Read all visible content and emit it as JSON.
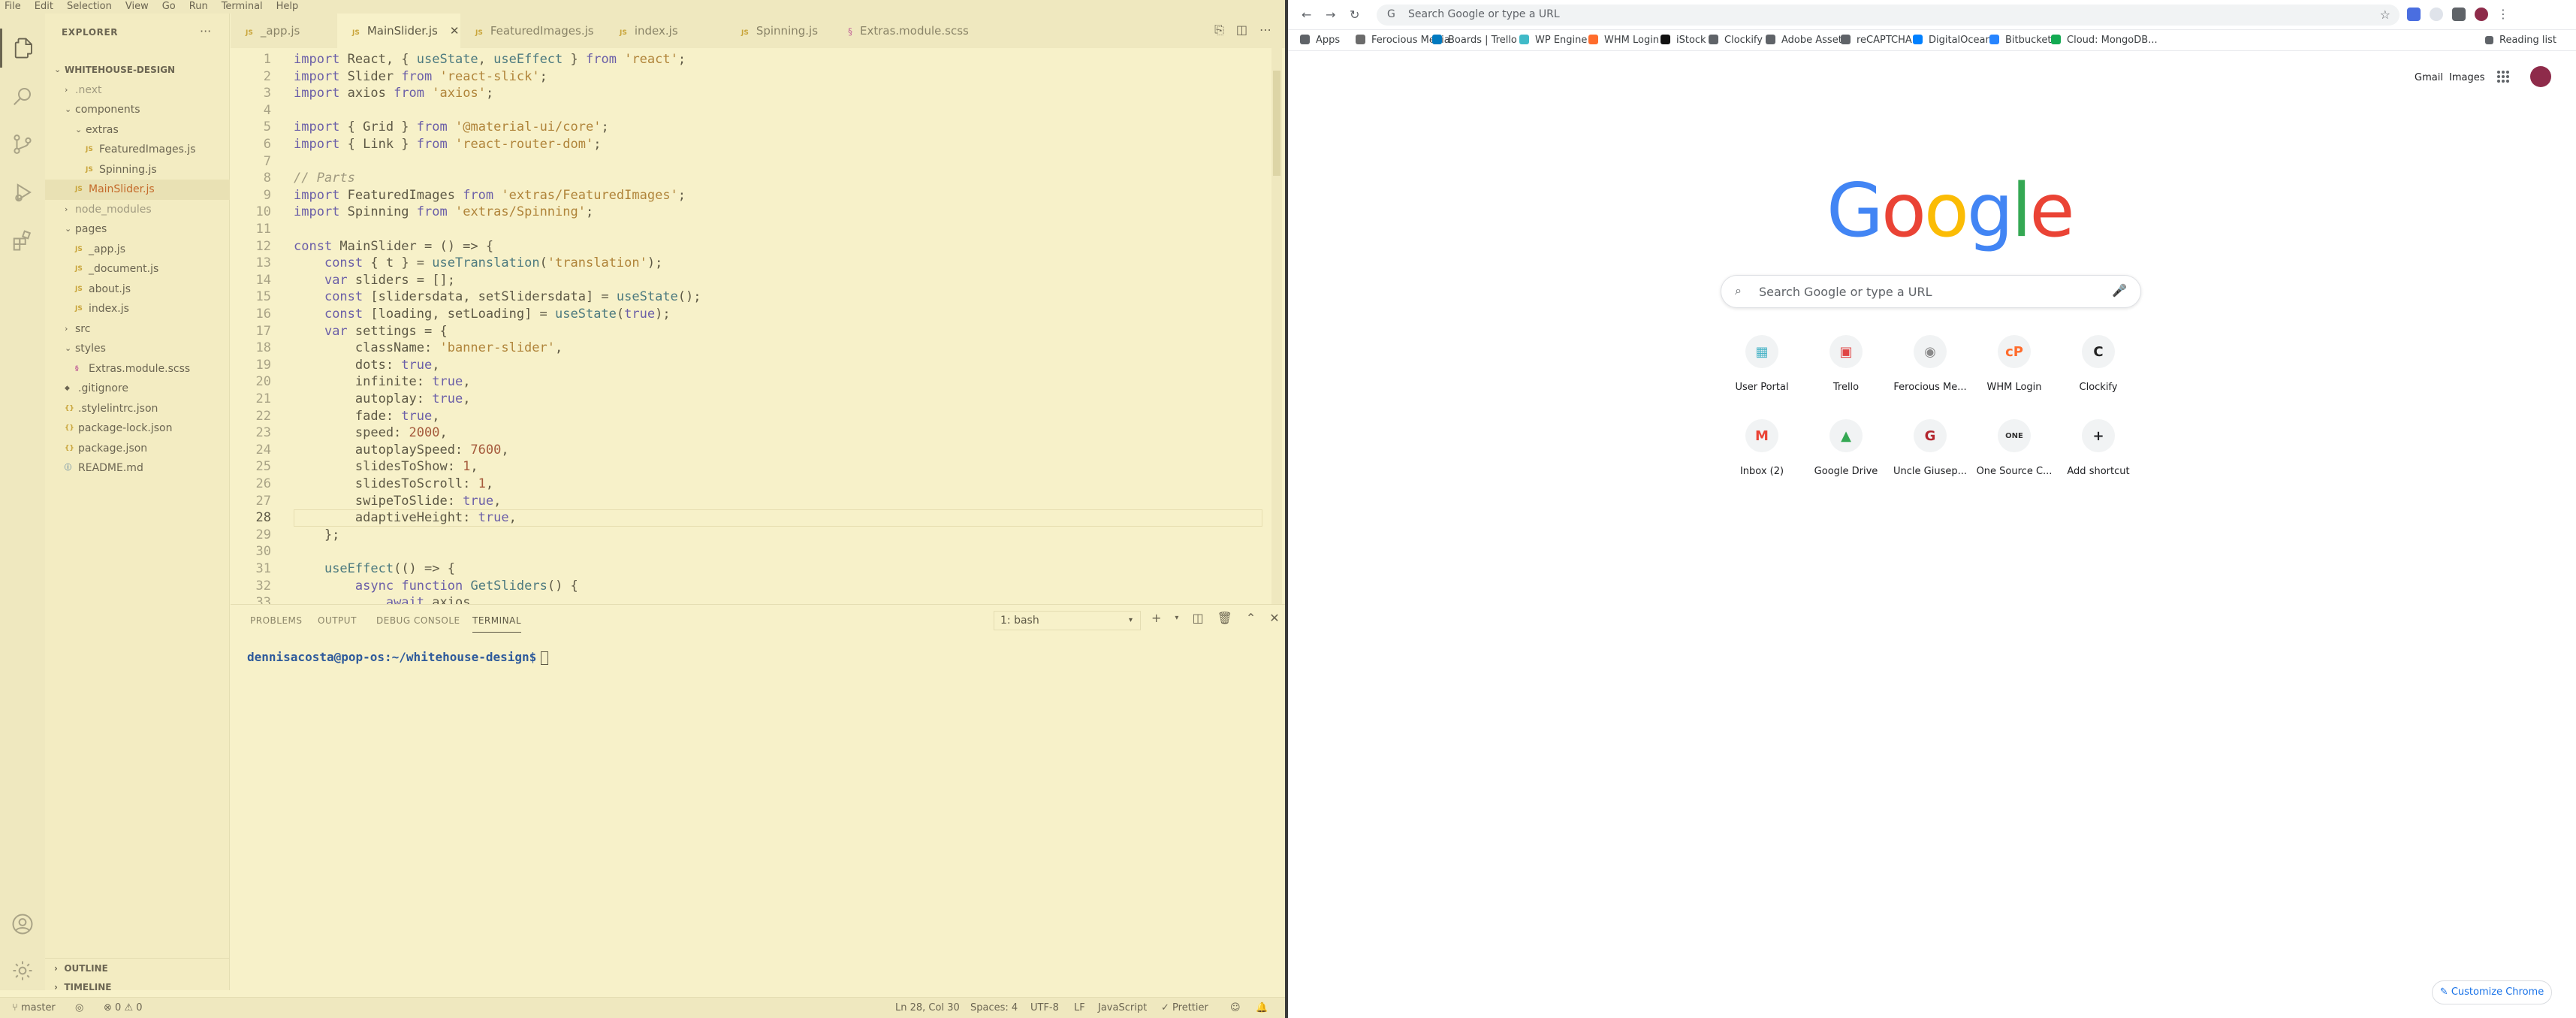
{
  "vscode": {
    "menu": [
      "File",
      "Edit",
      "Selection",
      "View",
      "Go",
      "Run",
      "Terminal",
      "Help"
    ],
    "explorer_title": "EXPLORER",
    "explorer_more": "···",
    "tree": [
      {
        "label": "WHITEHOUSE-DESIGN",
        "type": "root"
      },
      {
        "label": ".next",
        "type": "folder",
        "state": "collapsed",
        "muted": true
      },
      {
        "label": "components",
        "type": "folder",
        "state": "expanded"
      },
      {
        "label": "extras",
        "type": "folder",
        "state": "expanded"
      },
      {
        "label": "FeaturedImages.js",
        "type": "js"
      },
      {
        "label": "Spinning.js",
        "type": "js"
      },
      {
        "label": "MainSlider.js",
        "type": "js",
        "selected": true
      },
      {
        "label": "node_modules",
        "type": "folder",
        "state": "collapsed",
        "muted": true
      },
      {
        "label": "pages",
        "type": "folder",
        "state": "expanded"
      },
      {
        "label": "_app.js",
        "type": "js"
      },
      {
        "label": "_document.js",
        "type": "js"
      },
      {
        "label": "about.js",
        "type": "js"
      },
      {
        "label": "index.js",
        "type": "js"
      },
      {
        "label": "src",
        "type": "folder",
        "state": "collapsed"
      },
      {
        "label": "styles",
        "type": "folder",
        "state": "expanded"
      },
      {
        "label": "Extras.module.scss",
        "type": "scss"
      },
      {
        "label": ".gitignore",
        "type": "git"
      },
      {
        "label": ".stylelintrc.json",
        "type": "json"
      },
      {
        "label": "package-lock.json",
        "type": "json"
      },
      {
        "label": "package.json",
        "type": "json"
      },
      {
        "label": "README.md",
        "type": "md"
      }
    ],
    "outline": "OUTLINE",
    "timeline": "TIMELINE",
    "tabs": [
      {
        "label": "_app.js",
        "icon": "JS"
      },
      {
        "label": "MainSlider.js",
        "icon": "JS",
        "active": true
      },
      {
        "label": "FeaturedImages.js",
        "icon": "JS"
      },
      {
        "label": "index.js",
        "icon": "JS"
      },
      {
        "label": "Spinning.js",
        "icon": "JS"
      },
      {
        "label": "Extras.module.scss",
        "icon": "scss"
      }
    ],
    "code_lines": [
      {
        "n": "1",
        "text": "import React, { useState, useEffect } from 'react';"
      },
      {
        "n": "2",
        "text": "import Slider from 'react-slick';"
      },
      {
        "n": "3",
        "text": "import axios from 'axios';"
      },
      {
        "n": "4",
        "text": ""
      },
      {
        "n": "5",
        "text": "import { Grid } from '@material-ui/core';"
      },
      {
        "n": "6",
        "text": "import { Link } from 'react-router-dom';"
      },
      {
        "n": "7",
        "text": ""
      },
      {
        "n": "8",
        "text": "// Parts"
      },
      {
        "n": "9",
        "text": "import FeaturedImages from 'extras/FeaturedImages';"
      },
      {
        "n": "10",
        "text": "import Spinning from 'extras/Spinning';"
      },
      {
        "n": "11",
        "text": ""
      },
      {
        "n": "12",
        "text": "const MainSlider = () => {"
      },
      {
        "n": "13",
        "text": "    const { t } = useTranslation('translation');"
      },
      {
        "n": "14",
        "text": "    var sliders = [];"
      },
      {
        "n": "15",
        "text": "    const [slidersdata, setSlidersdata] = useState();"
      },
      {
        "n": "16",
        "text": "    const [loading, setLoading] = useState(true);"
      },
      {
        "n": "17",
        "text": "    var settings = {"
      },
      {
        "n": "18",
        "text": "        className: 'banner-slider',"
      },
      {
        "n": "19",
        "text": "        dots: true,"
      },
      {
        "n": "20",
        "text": "        infinite: true,"
      },
      {
        "n": "21",
        "text": "        autoplay: true,"
      },
      {
        "n": "22",
        "text": "        fade: true,"
      },
      {
        "n": "23",
        "text": "        speed: 2000,"
      },
      {
        "n": "24",
        "text": "        autoplaySpeed: 7600,"
      },
      {
        "n": "25",
        "text": "        slidesToShow: 1,"
      },
      {
        "n": "26",
        "text": "        slidesToScroll: 1,"
      },
      {
        "n": "27",
        "text": "        swipeToSlide: true,"
      },
      {
        "n": "28",
        "text": "        adaptiveHeight: true,",
        "current": true
      },
      {
        "n": "29",
        "text": "    };"
      },
      {
        "n": "30",
        "text": ""
      },
      {
        "n": "31",
        "text": "    useEffect(() => {"
      },
      {
        "n": "32",
        "text": "        async function GetSliders() {"
      },
      {
        "n": "33",
        "text": "            await axios"
      }
    ],
    "panel_tabs": [
      "PROBLEMS",
      "OUTPUT",
      "DEBUG CONSOLE",
      "TERMINAL"
    ],
    "terminal_select": "1: bash",
    "terminal_prompt": "dennisacosta@pop-os:~/whitehouse-design$",
    "status": {
      "branch": "master",
      "errors": "0",
      "warnings": "0",
      "position": "Ln 28, Col 30",
      "spaces": "Spaces: 4",
      "encoding": "UTF-8",
      "eol": "LF",
      "language": "JavaScript",
      "prettier": "Prettier"
    }
  },
  "chrome": {
    "omnibox_placeholder": "Search Google or type a URL",
    "reading_list": "Reading list",
    "bookmarks": [
      {
        "label": "Apps",
        "color": "#5f6368"
      },
      {
        "label": "Ferocious Media",
        "color": "#6b6b6b"
      },
      {
        "label": "Boards | Trello",
        "color": "#0079bf"
      },
      {
        "label": "WP Engine",
        "color": "#40bac8"
      },
      {
        "label": "WHM Login",
        "color": "#ff6c2c"
      },
      {
        "label": "iStock",
        "color": "#111111"
      },
      {
        "label": "Clockify",
        "color": "#5f6368"
      },
      {
        "label": "Adobe Assets",
        "color": "#5f6368"
      },
      {
        "label": "reCAPTCHA",
        "color": "#5f6368"
      },
      {
        "label": "DigitalOcean",
        "color": "#0080ff"
      },
      {
        "label": "Bitbucket",
        "color": "#2684ff"
      },
      {
        "label": "Cloud: MongoDB...",
        "color": "#13aa52"
      }
    ],
    "top_links": {
      "gmail": "Gmail",
      "images": "Images"
    },
    "logo_letters": [
      {
        "ch": "G",
        "color": "#4285f4"
      },
      {
        "ch": "o",
        "color": "#ea4335"
      },
      {
        "ch": "o",
        "color": "#fbbc05"
      },
      {
        "ch": "g",
        "color": "#4285f4"
      },
      {
        "ch": "l",
        "color": "#34a853"
      },
      {
        "ch": "e",
        "color": "#ea4335"
      }
    ],
    "search_placeholder": "Search Google or type a URL",
    "shortcuts": [
      {
        "label": "User Portal",
        "glyph": "▦",
        "color": "#4ab4c7"
      },
      {
        "label": "Trello",
        "glyph": "▣",
        "color": "#e04444"
      },
      {
        "label": "Ferocious Me...",
        "glyph": "◉",
        "color": "#8a8a8a"
      },
      {
        "label": "WHM Login",
        "glyph": "cP",
        "color": "#ff6c2c"
      },
      {
        "label": "Clockify",
        "glyph": "C",
        "color": "#222222"
      },
      {
        "label": "Inbox (2)",
        "glyph": "M",
        "color": "#ea4335"
      },
      {
        "label": "Google Drive",
        "glyph": "▲",
        "color": "#34a853"
      },
      {
        "label": "Uncle Giusep...",
        "glyph": "G",
        "color": "#b3262e"
      },
      {
        "label": "One Source C...",
        "glyph": "ONE",
        "color": "#333333"
      },
      {
        "label": "Add shortcut",
        "glyph": "+",
        "color": "#202124"
      }
    ],
    "customize_label": "Customize Chrome"
  }
}
